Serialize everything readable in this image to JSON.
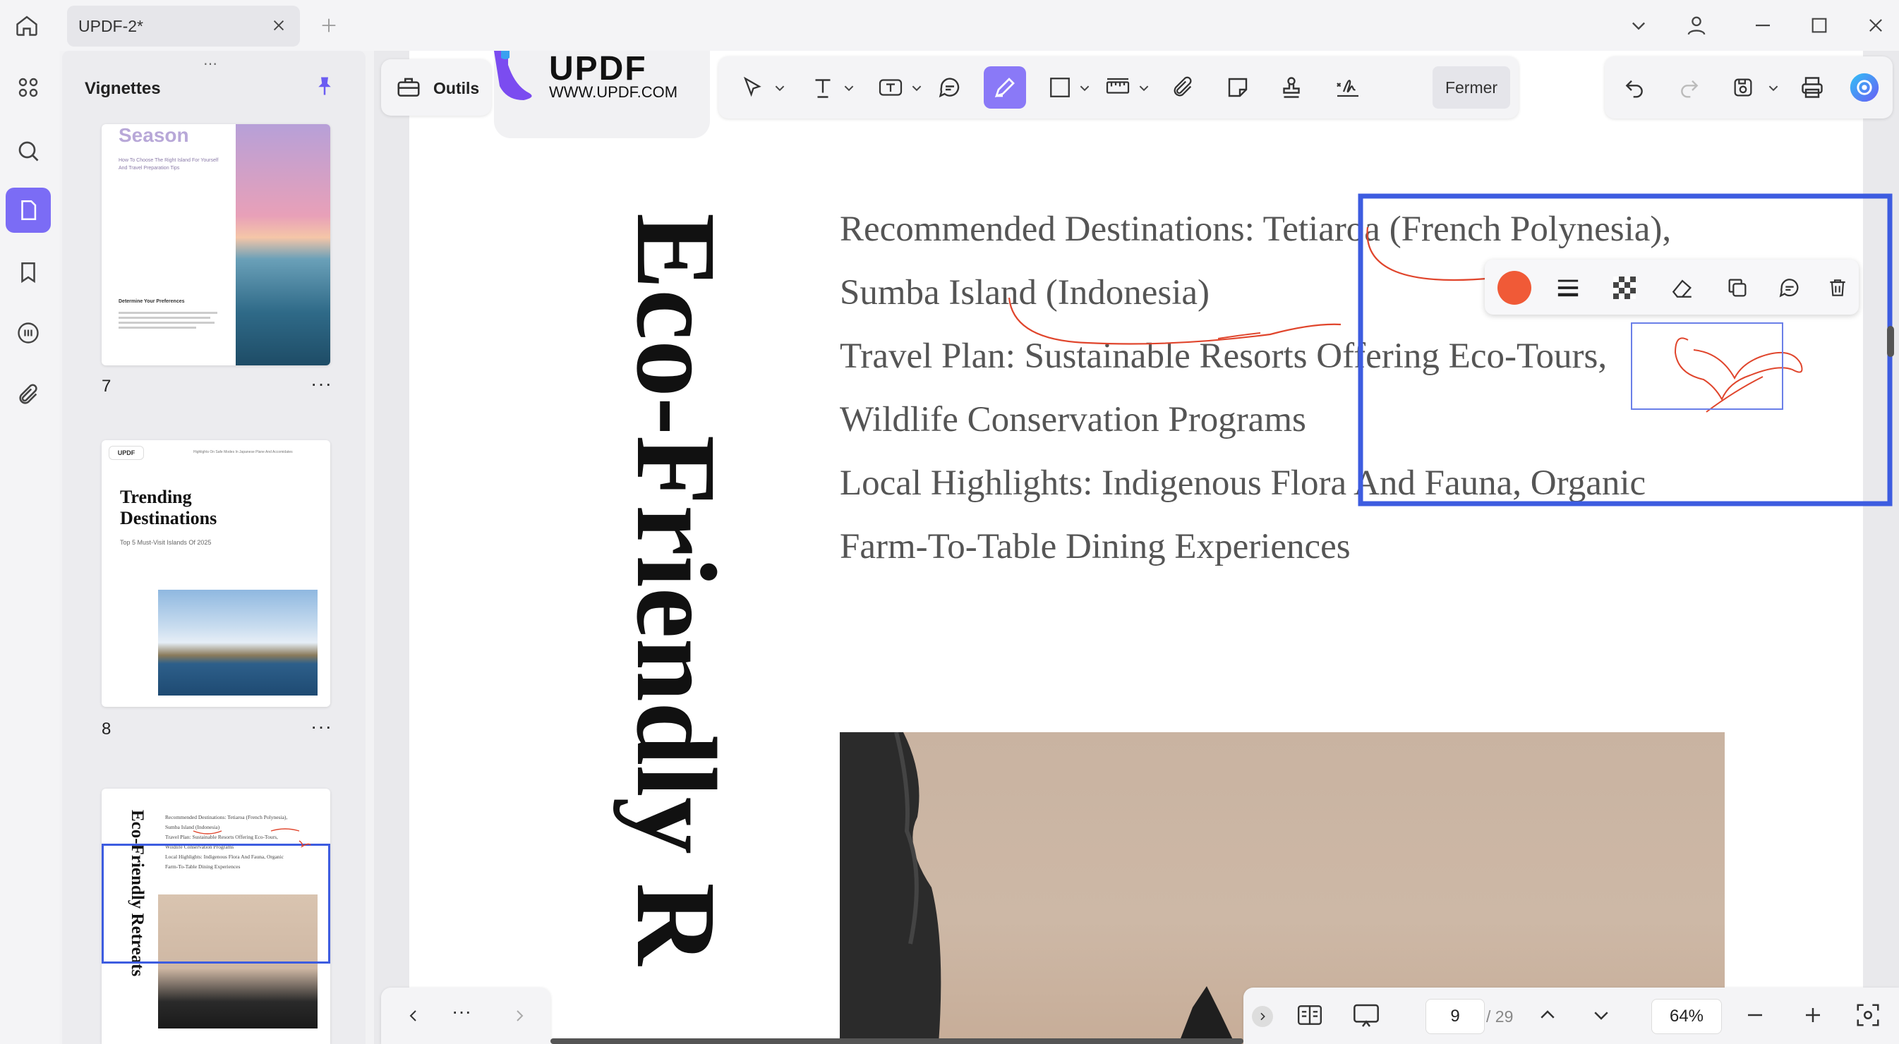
{
  "colors": {
    "accent": "#7b6cf5",
    "selection": "#3d5ce0",
    "annotation_red": "#f05a37",
    "highlight_pen": "#e0452c"
  },
  "tab": {
    "title": "UPDF-2*"
  },
  "panel": {
    "title": "Vignettes"
  },
  "thumbnails": [
    {
      "number": "7",
      "season": "Season",
      "subtitle": "How To Choose The Right Island For Yourself And Travel Preparation Tips",
      "section": "Determine Your Preferences"
    },
    {
      "number": "8",
      "brand": "UPDF",
      "title_line1": "Trending",
      "title_line2": "Destinations",
      "subtitle": "Top 5 Must-Visit Islands Of 2025",
      "header": "Highlights On Safe Modes In Japanese Plane And Accomidates"
    },
    {
      "number": "9",
      "vertical_title": "Eco-Friendly Retreats"
    }
  ],
  "toolbar": {
    "outils_label": "Outils",
    "logo_text": "UPDF",
    "logo_url": "WWW.UPDF.COM",
    "fermer_label": "Fermer"
  },
  "document": {
    "vertical_title": "Eco-Friendly R",
    "lines": [
      "Recommended Destinations: Tetiaroa (French Polynesia),",
      "Sumba Island (Indonesia)",
      "Travel Plan: Sustainable Resorts Offering Eco-Tours,",
      "Wildlife Conservation Programs",
      "Local Highlights: Indigenous Flora And Fauna, Organic",
      "Farm-To-Table Dining Experiences"
    ]
  },
  "bottom": {
    "page_current": "9",
    "page_total": "/ 29",
    "zoom": "64%",
    "ellipsis": "···"
  }
}
